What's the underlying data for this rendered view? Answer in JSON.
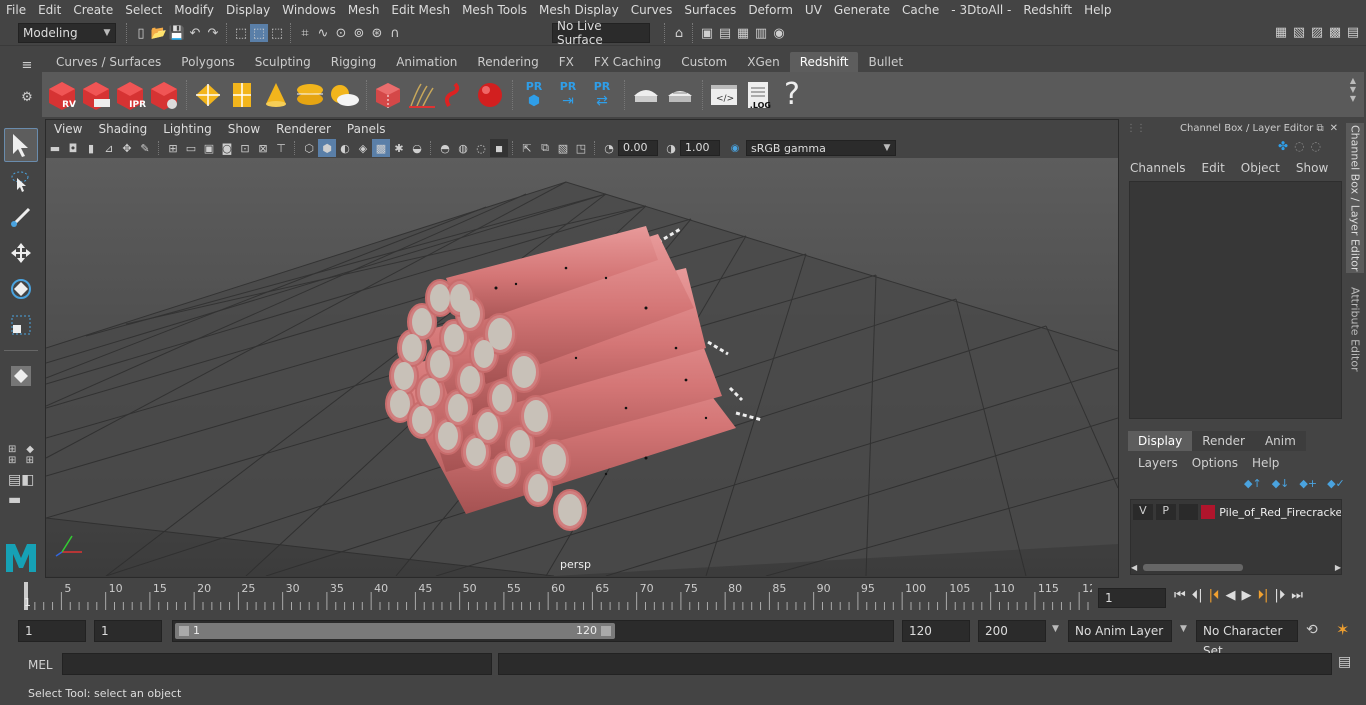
{
  "menubar": {
    "items": [
      "File",
      "Edit",
      "Create",
      "Select",
      "Modify",
      "Display",
      "Windows",
      "Mesh",
      "Edit Mesh",
      "Mesh Tools",
      "Mesh Display",
      "Curves",
      "Surfaces",
      "Deform",
      "UV",
      "Generate",
      "Cache",
      "- 3DtoAll -",
      "Redshift",
      "Help"
    ]
  },
  "statusline": {
    "mode": "Modeling",
    "live_surface": "No Live Surface"
  },
  "shelf": {
    "tabs": [
      "Curves / Surfaces",
      "Polygons",
      "Sculpting",
      "Rigging",
      "Animation",
      "Rendering",
      "FX",
      "FX Caching",
      "Custom",
      "XGen",
      "Redshift",
      "Bullet"
    ],
    "active_tab": "Redshift",
    "icon_labels": {
      "rv": "RV",
      "ipr": "IPR",
      "pr": "PR",
      "log": ".LOG"
    }
  },
  "viewport": {
    "menus": [
      "View",
      "Shading",
      "Lighting",
      "Show",
      "Renderer",
      "Panels"
    ],
    "exposure": "0.00",
    "gamma": "1.00",
    "colorspace": "sRGB gamma",
    "camera_label": "persp"
  },
  "channel_box": {
    "title": "Channel Box / Layer Editor",
    "menus": [
      "Channels",
      "Edit",
      "Object",
      "Show"
    ]
  },
  "layer_editor": {
    "tabs": [
      "Display",
      "Render",
      "Anim"
    ],
    "active_tab": "Display",
    "menus": [
      "Layers",
      "Options",
      "Help"
    ],
    "layer": {
      "v": "V",
      "p": "P",
      "name": "Pile_of_Red_Firecracke",
      "color": "#b0152c"
    }
  },
  "side_tabs": [
    "Channel Box / Layer Editor",
    "Attribute Editor"
  ],
  "timeline": {
    "ticks": [
      "5",
      "10",
      "15",
      "20",
      "25",
      "30",
      "35",
      "40",
      "45",
      "50",
      "55",
      "60",
      "65",
      "70",
      "75",
      "80",
      "85",
      "90",
      "95",
      "100",
      "105",
      "110",
      "115",
      "12"
    ],
    "start_label": "1",
    "current_frame": "1"
  },
  "range": {
    "start": "1",
    "playback_start": "1",
    "slider_min": "1",
    "slider_max": "120",
    "playback_end": "120",
    "end": "200",
    "anim_layer": "No Anim Layer",
    "character_set": "No Character Set"
  },
  "command": {
    "lang": "MEL"
  },
  "help_line": "Select Tool: select an object"
}
